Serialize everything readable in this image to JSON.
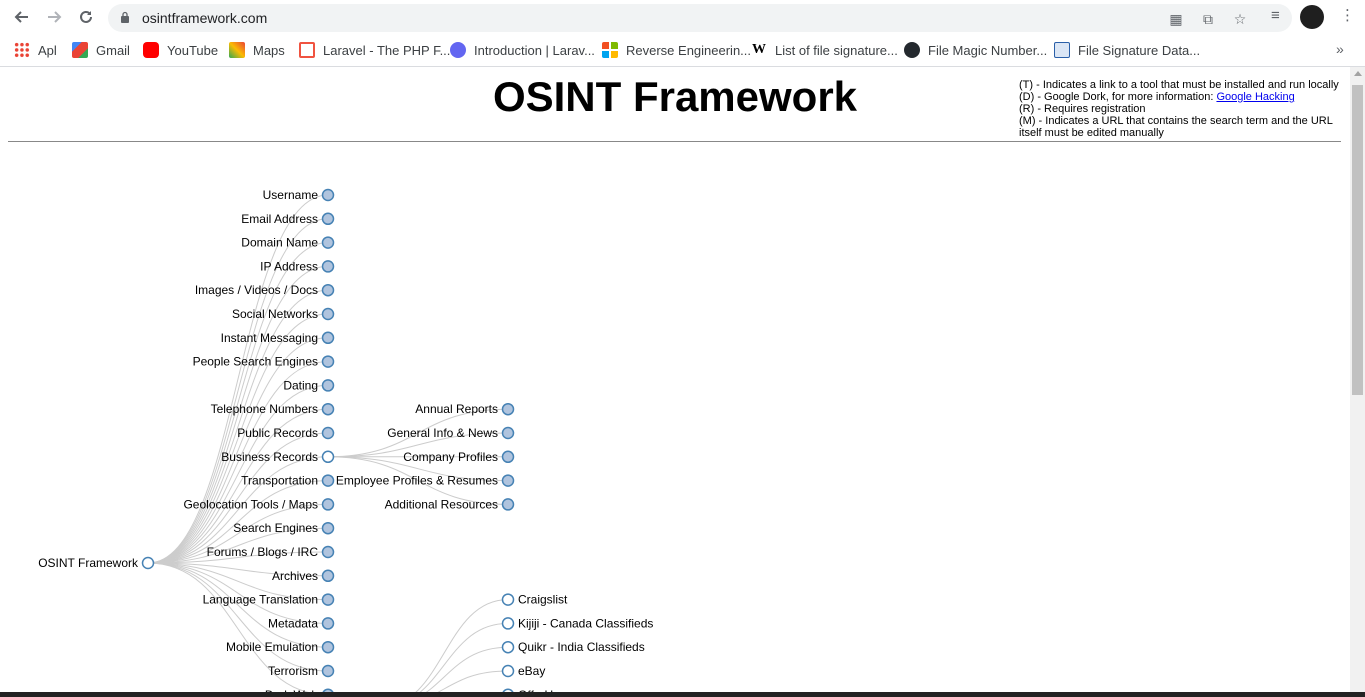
{
  "browser": {
    "url": "osintframework.com",
    "bookmarks": [
      {
        "label": "Apl",
        "icon": "apps-grid-icon"
      },
      {
        "label": "Gmail",
        "icon": "gmail-icon"
      },
      {
        "label": "YouTube",
        "icon": "youtube-icon"
      },
      {
        "label": "Maps",
        "icon": "maps-icon"
      },
      {
        "label": "Laravel - The PHP F...",
        "icon": "laravel-icon"
      },
      {
        "label": "Introduction | Larav...",
        "icon": "laracasts-icon"
      },
      {
        "label": "Reverse Engineerin...",
        "icon": "microsoft-icon"
      },
      {
        "label": "List of file signature...",
        "icon": "wikipedia-icon"
      },
      {
        "label": "File Magic Number...",
        "icon": "github-icon"
      },
      {
        "label": "File Signature Data...",
        "icon": "filesig-icon"
      }
    ],
    "more_bookmarks": "»"
  },
  "page": {
    "title": "OSINT Framework",
    "legend": {
      "line1": "(T) - Indicates a link to a tool that must be installed and run locally",
      "line2_prefix": "(D) - Google Dork, for more information: ",
      "line2_link": "Google Hacking",
      "line3": "(R) - Requires registration",
      "line4": "(M) - Indicates a URL that contains the search term and the URL itself must be edited manually"
    }
  },
  "tree": {
    "root": "OSINT Framework",
    "categories": [
      {
        "label": "Username",
        "open": false
      },
      {
        "label": "Email Address",
        "open": false
      },
      {
        "label": "Domain Name",
        "open": false
      },
      {
        "label": "IP Address",
        "open": false
      },
      {
        "label": "Images / Videos / Docs",
        "open": false
      },
      {
        "label": "Social Networks",
        "open": false
      },
      {
        "label": "Instant Messaging",
        "open": false
      },
      {
        "label": "People Search Engines",
        "open": false
      },
      {
        "label": "Dating",
        "open": false
      },
      {
        "label": "Telephone Numbers",
        "open": false
      },
      {
        "label": "Public Records",
        "open": false
      },
      {
        "label": "Business Records",
        "open": true
      },
      {
        "label": "Transportation",
        "open": false
      },
      {
        "label": "Geolocation Tools / Maps",
        "open": false
      },
      {
        "label": "Search Engines",
        "open": false
      },
      {
        "label": "Forums / Blogs / IRC",
        "open": false
      },
      {
        "label": "Archives",
        "open": false
      },
      {
        "label": "Language Translation",
        "open": false
      },
      {
        "label": "Metadata",
        "open": false
      },
      {
        "label": "Mobile Emulation",
        "open": false
      },
      {
        "label": "Terrorism",
        "open": false
      },
      {
        "label": "Dark Web",
        "open": false
      }
    ],
    "business_records_children": [
      "Annual Reports",
      "General Info & News",
      "Company Profiles",
      "Employee Profiles & Resumes",
      "Additional Resources"
    ],
    "classifieds_children": [
      "Craigslist",
      "Kijiji - Canada Classifieds",
      "Quikr - India Classifieds",
      "eBay",
      "OfferUp"
    ]
  }
}
